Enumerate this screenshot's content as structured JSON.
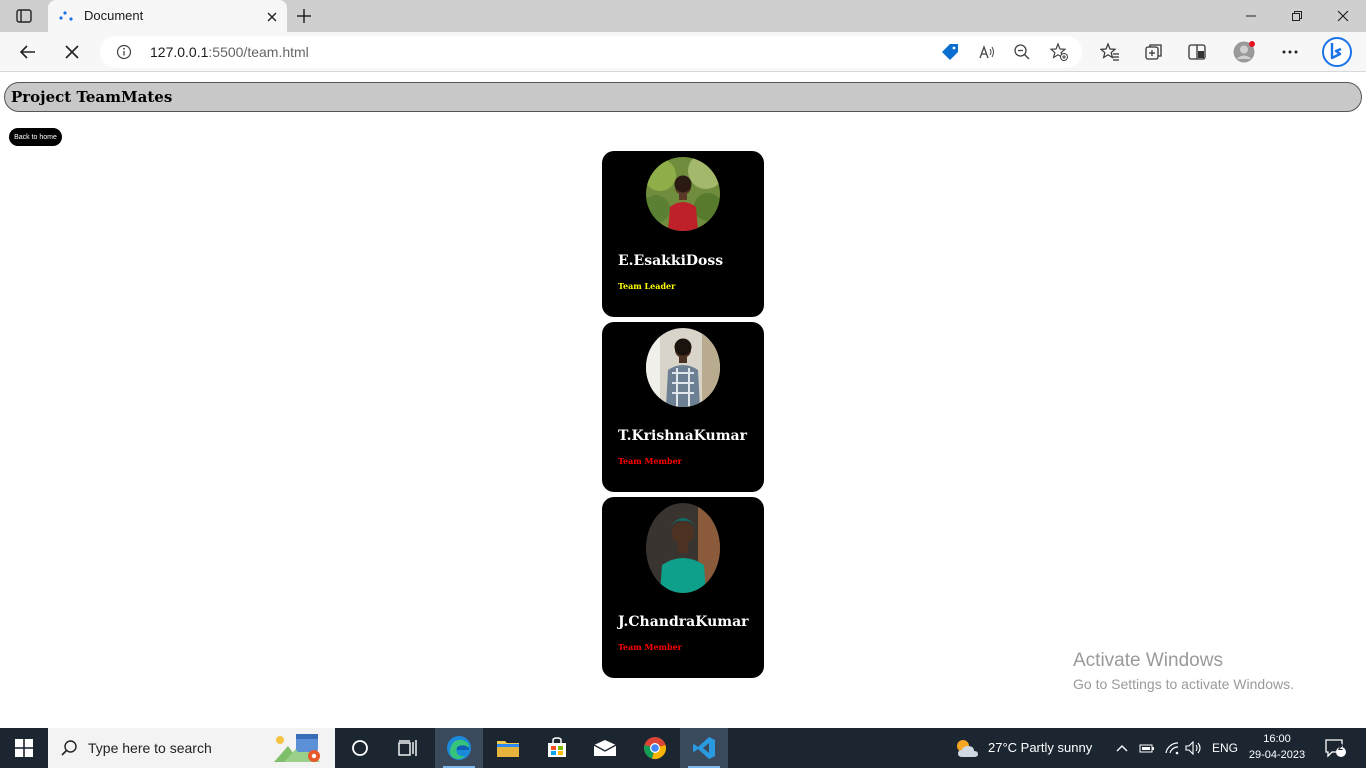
{
  "browser": {
    "tab_title": "Document",
    "url_host": "127.0.0.1",
    "url_rest": ":5500/team.html"
  },
  "page": {
    "heading": "Project TeamMates",
    "back_button": "Back to home",
    "members": [
      {
        "name": "E.EsakkiDoss",
        "role": "Team Leader",
        "role_color": "#ffff00"
      },
      {
        "name": "T.KrishnaKumar",
        "role": "Team Member",
        "role_color": "#ff0000"
      },
      {
        "name": "J.ChandraKumar",
        "role": "Team Member",
        "role_color": "#ff0000"
      }
    ],
    "watermark": {
      "line1": "Activate Windows",
      "line2": "Go to Settings to activate Windows."
    }
  },
  "taskbar": {
    "search_placeholder": "Type here to search",
    "weather": "27°C  Partly sunny",
    "language": "ENG",
    "time": "16:00",
    "date": "29-04-2023",
    "notification_count": "2"
  }
}
